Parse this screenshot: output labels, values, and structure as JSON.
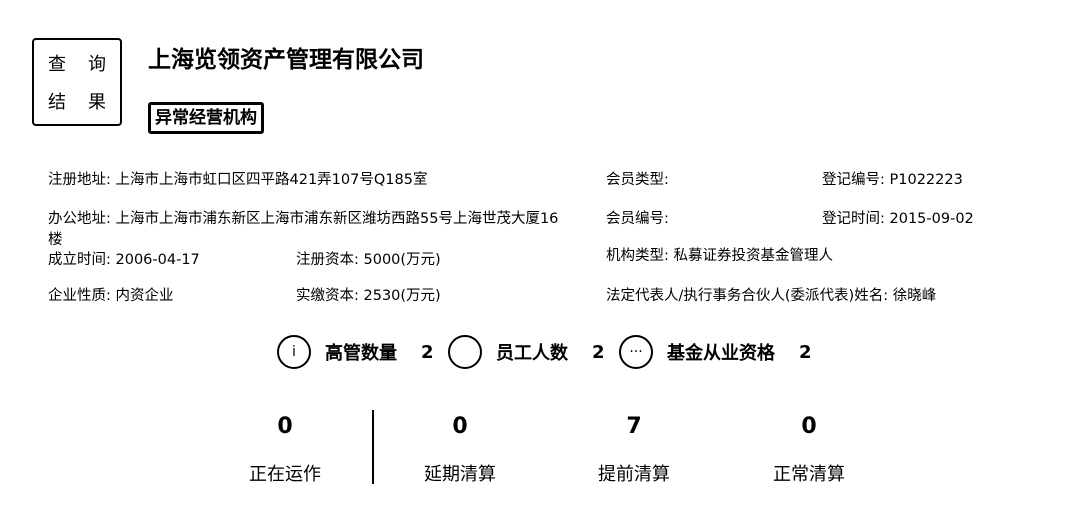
{
  "seal": {
    "chars": [
      "查",
      "询",
      "结",
      "果"
    ]
  },
  "company_name": "上海览领资产管理有限公司",
  "badge": "异常经营机构",
  "fields": {
    "reg_address": {
      "label": "注册地址:",
      "value": "上海市上海市虹口区四平路421弄107号Q185室"
    },
    "member_type": {
      "label": "会员类型:",
      "value": ""
    },
    "reg_number": {
      "label": "登记编号:",
      "value": "P1022223"
    },
    "office_address": {
      "label": "办公地址:",
      "value": "上海市上海市浦东新区上海市浦东新区潍坊西路55号上海世茂大厦16楼"
    },
    "member_code": {
      "label": "会员编号:",
      "value": ""
    },
    "reg_time": {
      "label": "登记时间:",
      "value": "2015-09-02"
    },
    "found_time": {
      "label": "成立时间:",
      "value": "2006-04-17"
    },
    "reg_capital": {
      "label": "注册资本:",
      "value": "5000(万元)"
    },
    "org_type": {
      "label": "机构类型:",
      "value": "私募证券投资基金管理人"
    },
    "enterprise_nature": {
      "label": "企业性质:",
      "value": "内资企业"
    },
    "paid_capital": {
      "label": "实缴资本:",
      "value": "2530(万元)"
    },
    "legal_rep": {
      "label": "法定代表人/执行事务合伙人(委派代表)姓名:",
      "value": "徐晓峰"
    }
  },
  "counts": [
    {
      "icon": "info-icon",
      "label": "高管数量",
      "value": "2"
    },
    {
      "icon": "person-icon",
      "label": "员工人数",
      "value": "2"
    },
    {
      "icon": "chat-icon",
      "label": "基金从业资格",
      "value": "2"
    }
  ],
  "stats": [
    {
      "label": "正在运作",
      "value": "0"
    },
    {
      "label": "延期清算",
      "value": "0"
    },
    {
      "label": "提前清算",
      "value": "7"
    },
    {
      "label": "正常清算",
      "value": "0"
    }
  ]
}
